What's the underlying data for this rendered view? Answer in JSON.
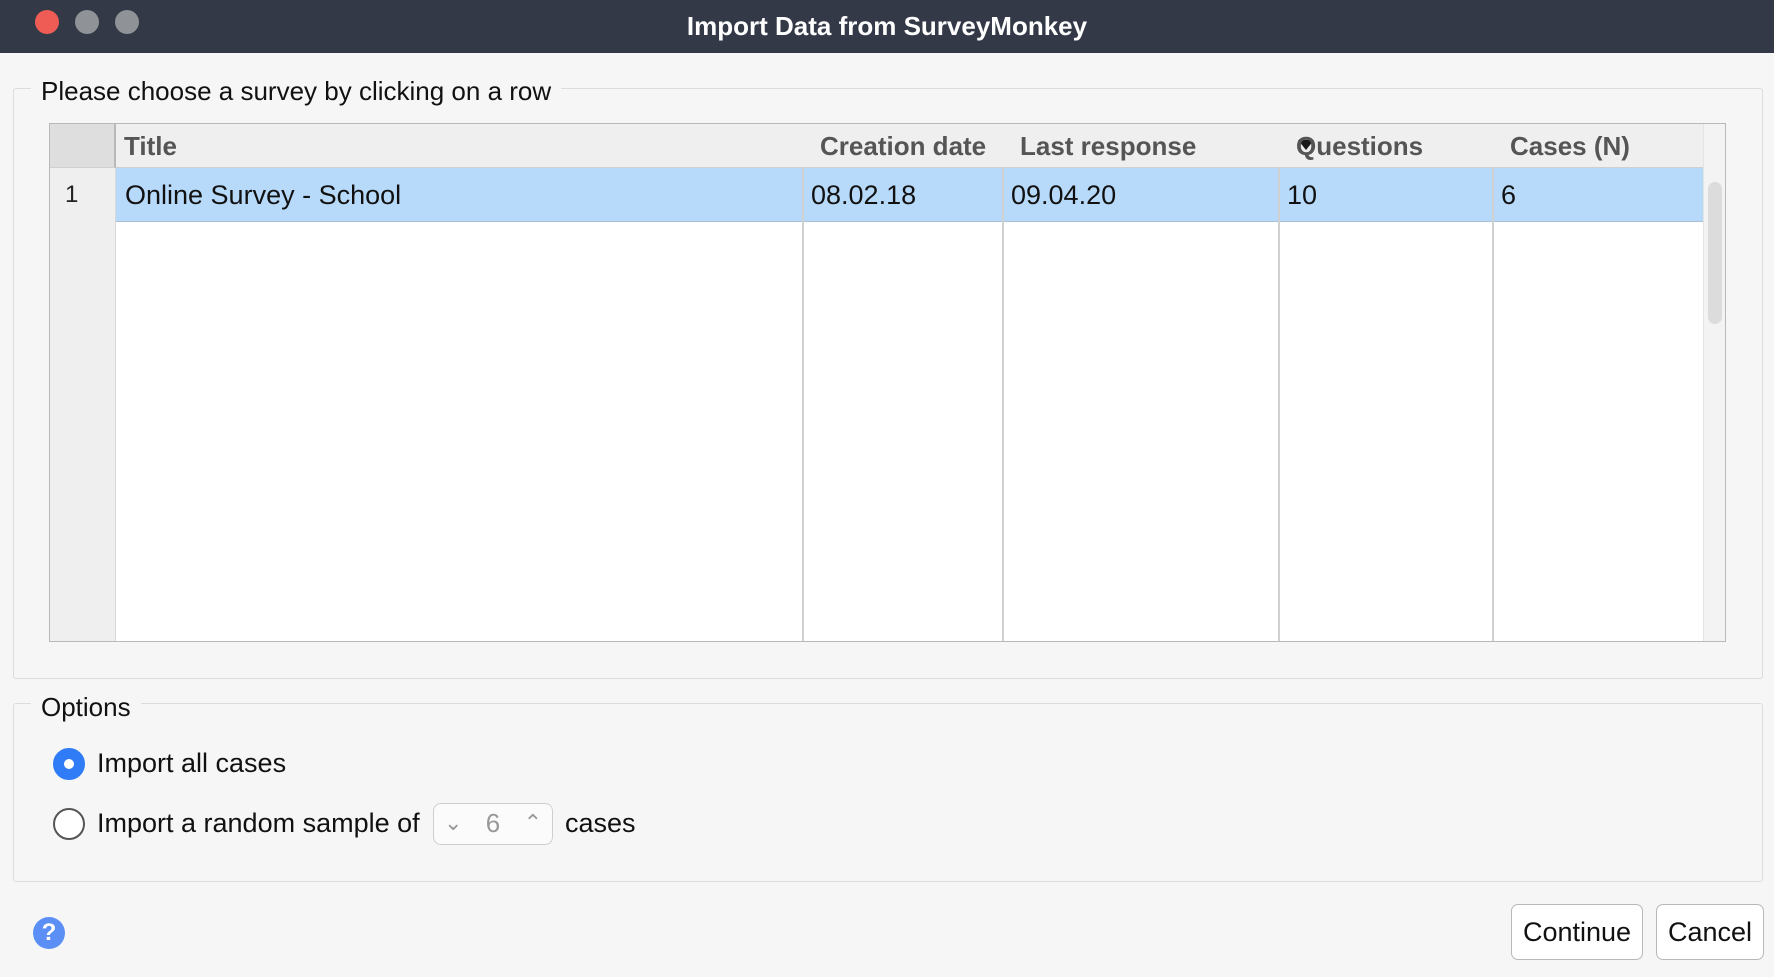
{
  "window": {
    "title": "Import Data from SurveyMonkey"
  },
  "survey_section": {
    "legend": "Please choose a survey by clicking on a row",
    "columns": [
      "Title",
      "Creation date",
      "Last response",
      "Questions",
      "Cases (N)"
    ],
    "sorted_column": "Last response",
    "rows": [
      {
        "num": "1",
        "title": "Online Survey - School",
        "created": "08.02.18",
        "last_response": "09.04.20",
        "questions": "10",
        "cases": "6"
      }
    ]
  },
  "options": {
    "legend": "Options",
    "import_all": "Import all cases",
    "import_sample": "Import a random sample of",
    "sample_value": "6",
    "sample_suffix": "cases",
    "selected": "import_all"
  },
  "buttons": {
    "continue": "Continue",
    "cancel": "Cancel",
    "help": "?"
  },
  "colors": {
    "titlebar": "#333947",
    "selection": "#b8dafa",
    "accent": "#2f7cf6"
  }
}
